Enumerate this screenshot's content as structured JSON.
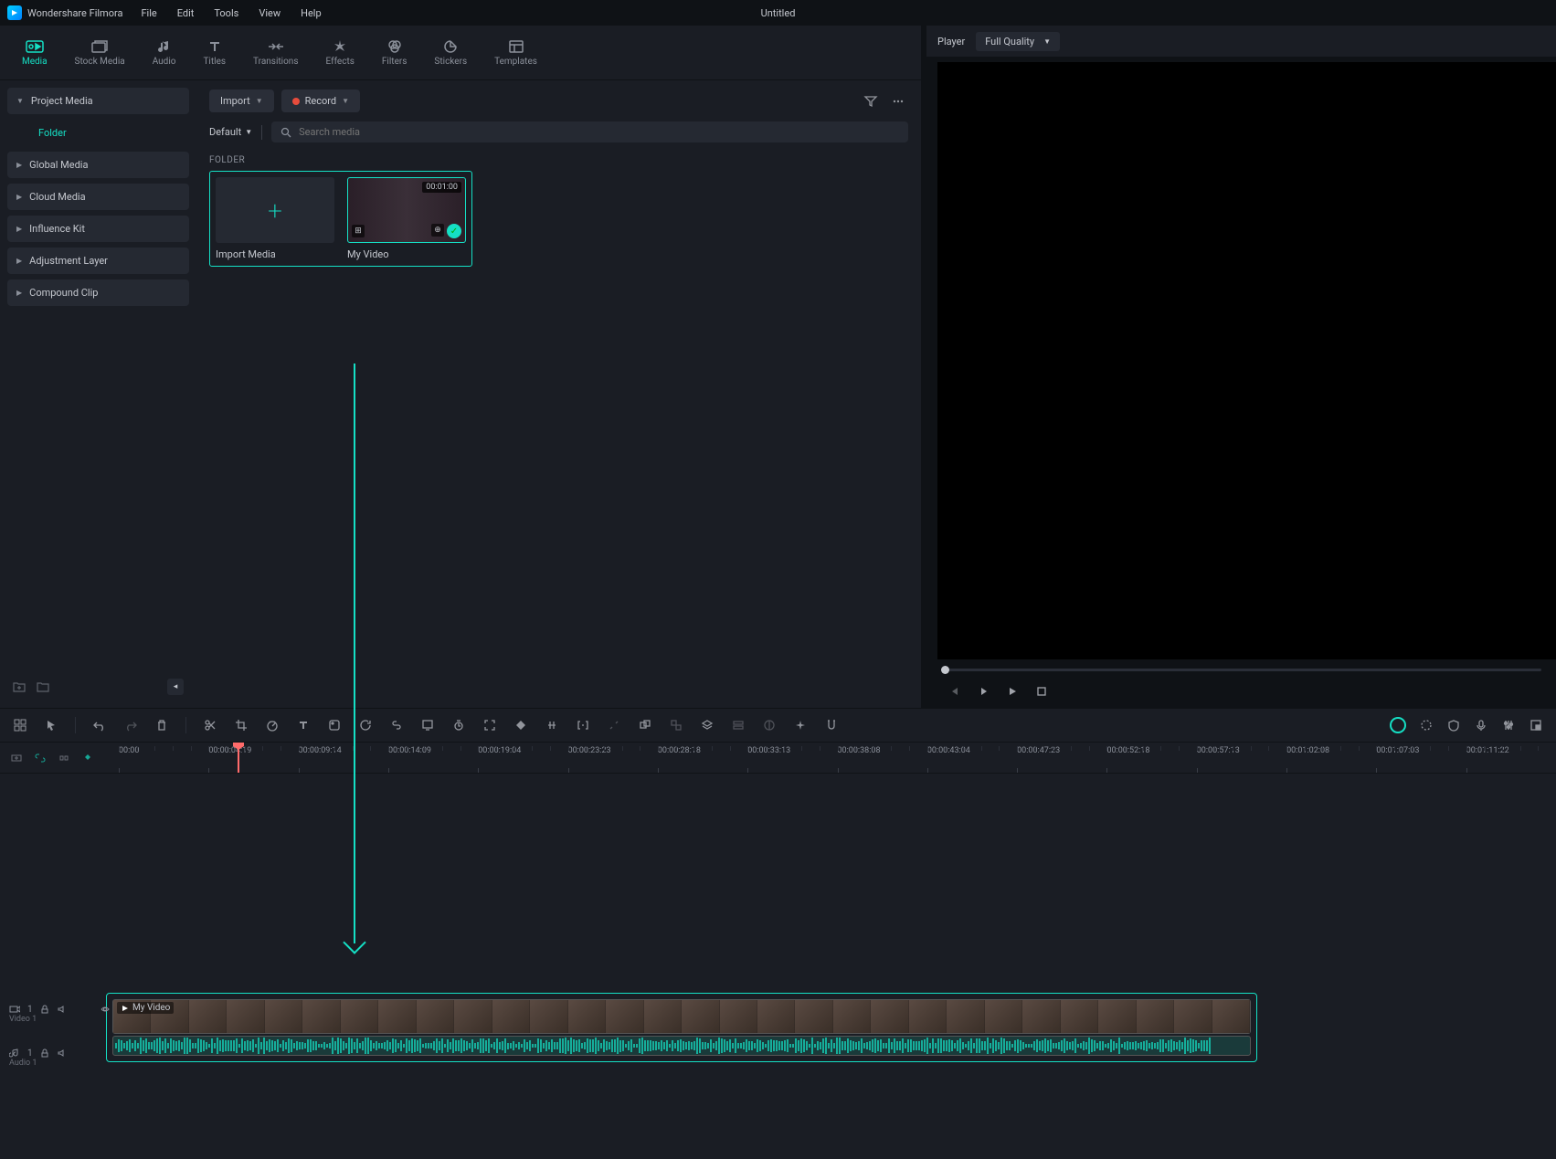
{
  "app": {
    "name": "Wondershare Filmora",
    "title": "Untitled"
  },
  "menu": [
    "File",
    "Edit",
    "Tools",
    "View",
    "Help"
  ],
  "tabs": [
    {
      "label": "Media",
      "active": true
    },
    {
      "label": "Stock Media"
    },
    {
      "label": "Audio"
    },
    {
      "label": "Titles"
    },
    {
      "label": "Transitions"
    },
    {
      "label": "Effects"
    },
    {
      "label": "Filters"
    },
    {
      "label": "Stickers"
    },
    {
      "label": "Templates"
    }
  ],
  "sidebar": {
    "items": [
      {
        "label": "Project Media",
        "expanded": true,
        "children": [
          {
            "label": "Folder",
            "selected": true
          }
        ]
      },
      {
        "label": "Global Media"
      },
      {
        "label": "Cloud Media"
      },
      {
        "label": "Influence Kit"
      },
      {
        "label": "Adjustment Layer"
      },
      {
        "label": "Compound Clip"
      }
    ]
  },
  "media": {
    "import_btn": "Import",
    "record_btn": "Record",
    "sort": "Default",
    "search_placeholder": "Search media",
    "folder_label": "FOLDER",
    "thumbs": [
      {
        "label": "Import Media",
        "kind": "add"
      },
      {
        "label": "My Video",
        "kind": "video",
        "duration": "00:01:00",
        "selected": true
      }
    ]
  },
  "player": {
    "label": "Player",
    "quality": "Full Quality"
  },
  "timeline": {
    "ticks": [
      "00:00",
      "00:00:04:19",
      "00:00:09:14",
      "00:00:14:09",
      "00:00:19:04",
      "00:00:23:23",
      "00:00:28:18",
      "00:00:33:13",
      "00:00:38:08",
      "00:00:43:04",
      "00:00:47:23",
      "00:00:52:18",
      "00:00:57:13",
      "00:01:02:08",
      "00:01:07:03",
      "00:01:11:22"
    ],
    "tracks": {
      "video": {
        "label": "Video 1",
        "num": "1"
      },
      "audio": {
        "label": "Audio 1",
        "num": "1"
      }
    },
    "clip": {
      "name": "My Video"
    },
    "cts": "‹"
  }
}
